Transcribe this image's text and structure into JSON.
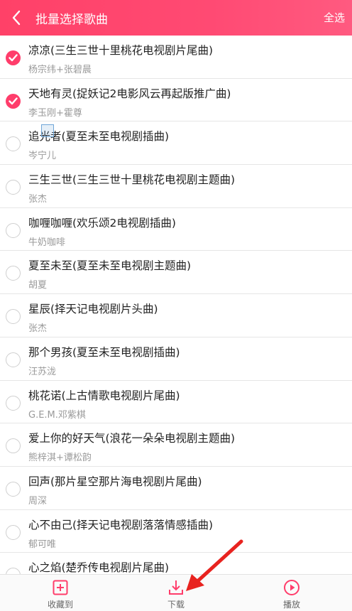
{
  "header": {
    "title": "批量选择歌曲",
    "select_all_label": "全选",
    "accent_color": "#ff4a73"
  },
  "songs": [
    {
      "title": "凉凉(三生三世十里桃花电视剧片尾曲)",
      "artist": "杨宗纬+张碧晨",
      "checked": true
    },
    {
      "title": "天地有灵(捉妖记2电影风云再起版推广曲)",
      "artist": "李玉刚+霍尊",
      "checked": true
    },
    {
      "title": "追光者(夏至未至电视剧插曲)",
      "artist": "岑宁儿",
      "checked": false
    },
    {
      "title": "三生三世(三生三世十里桃花电视剧主题曲)",
      "artist": "张杰",
      "checked": false
    },
    {
      "title": "咖喱咖喱(欢乐颂2电视剧插曲)",
      "artist": "牛奶咖啡",
      "checked": false
    },
    {
      "title": "夏至未至(夏至未至电视剧主题曲)",
      "artist": "胡夏",
      "checked": false
    },
    {
      "title": "星辰(择天记电视剧片头曲)",
      "artist": "张杰",
      "checked": false
    },
    {
      "title": "那个男孩(夏至未至电视剧插曲)",
      "artist": "汪苏泷",
      "checked": false
    },
    {
      "title": "桃花诺(上古情歌电视剧片尾曲)",
      "artist": "G.E.M.邓紫棋",
      "checked": false
    },
    {
      "title": "爱上你的好天气(浪花一朵朵电视剧主题曲)",
      "artist": "熊梓淇+谭松韵",
      "checked": false
    },
    {
      "title": "回声(那片星空那片海电视剧片尾曲)",
      "artist": "周深",
      "checked": false
    },
    {
      "title": "心不由己(择天记电视剧落落情感插曲)",
      "artist": "郁可唯",
      "checked": false
    },
    {
      "title": "心之焰(楚乔传电视剧片尾曲)",
      "artist": "",
      "checked": false
    }
  ],
  "bottombar": {
    "favorite_label": "收藏到",
    "download_label": "下载",
    "play_label": "播放",
    "icon_color": "#ff3d6b"
  }
}
